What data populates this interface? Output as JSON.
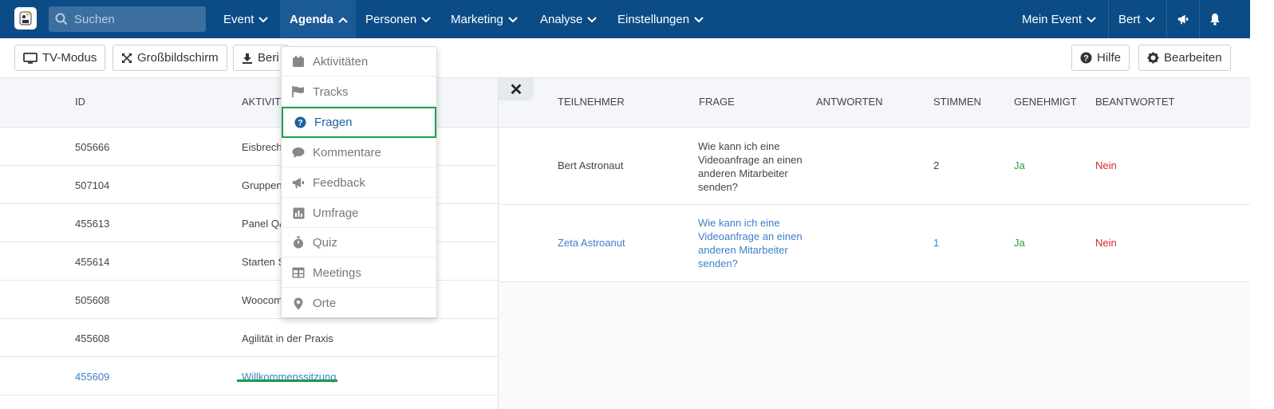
{
  "navbar": {
    "search_placeholder": "Suchen",
    "items": [
      {
        "label": "Event"
      },
      {
        "label": "Agenda"
      },
      {
        "label": "Personen"
      },
      {
        "label": "Marketing"
      },
      {
        "label": "Analyse"
      },
      {
        "label": "Einstellungen"
      }
    ],
    "right": {
      "event_label": "Mein Event",
      "user_label": "Bert"
    },
    "colors": {
      "bar": "#0b4c86",
      "active": "#1a5a95"
    }
  },
  "toolbar": {
    "tv_mode": "TV-Modus",
    "fullscreen": "Großbildschirm",
    "report": "Beri",
    "help": "Hilfe",
    "edit": "Bearbeiten"
  },
  "dropdown": {
    "items": [
      {
        "label": "Aktivitäten",
        "icon": "calendar-icon"
      },
      {
        "label": "Tracks",
        "icon": "flag-icon"
      },
      {
        "label": "Fragen",
        "icon": "question-circle-icon",
        "selected": true
      },
      {
        "label": "Kommentare",
        "icon": "comment-icon"
      },
      {
        "label": "Feedback",
        "icon": "megaphone-icon"
      },
      {
        "label": "Umfrage",
        "icon": "bar-chart-icon"
      },
      {
        "label": "Quiz",
        "icon": "stopwatch-icon"
      },
      {
        "label": "Meetings",
        "icon": "table-icon"
      },
      {
        "label": "Orte",
        "icon": "map-marker-icon"
      }
    ]
  },
  "activities_table": {
    "headers": {
      "id": "ID",
      "activity": "AKTIVITÄ"
    },
    "rows": [
      {
        "id": "505666",
        "activity": "Eisbrech"
      },
      {
        "id": "507104",
        "activity": "Gruppen"
      },
      {
        "id": "455613",
        "activity": "Panel Q&"
      },
      {
        "id": "455614",
        "activity": "Starten S"
      },
      {
        "id": "505608",
        "activity": "Woocom"
      },
      {
        "id": "455608",
        "activity": "Agilität in der Praxis"
      },
      {
        "id": "455609",
        "activity": "Willkommenssitzung"
      }
    ]
  },
  "questions_panel": {
    "headers": {
      "participant": "TEILNEHMER",
      "question": "FRAGE",
      "answers": "ANTWORTEN",
      "votes": "STIMMEN",
      "approved": "GENEHMIGT",
      "answered": "BEANTWORTET"
    },
    "rows": [
      {
        "participant": "Bert Astronaut",
        "question": "Wie kann ich eine Videoanfrage an einen anderen Mitarbeiter senden?",
        "answers": "",
        "votes": "2",
        "approved": "Ja",
        "answered": "Nein"
      },
      {
        "participant": "Zeta Astroanut",
        "question": "Wie kann ich eine Videoanfrage an einen anderen Mitarbeiter senden?",
        "answers": "",
        "votes": "1",
        "approved": "Ja",
        "answered": "Nein"
      }
    ]
  }
}
